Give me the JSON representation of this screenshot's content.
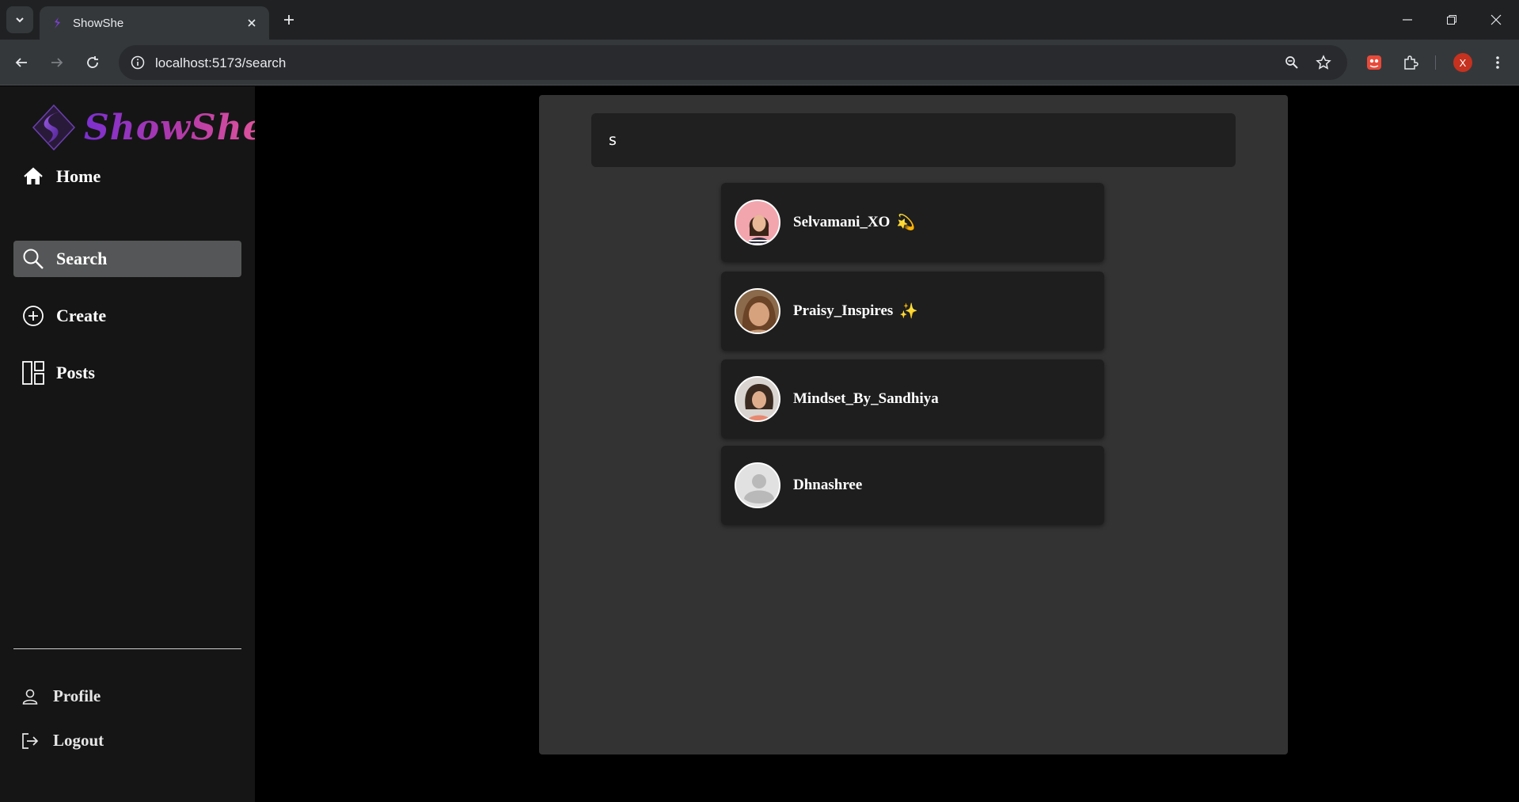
{
  "browser": {
    "tab_title": "ShowShe",
    "url": "localhost:5173/search",
    "profile_initial": "X"
  },
  "app": {
    "brand": "ShowShe",
    "nav": [
      {
        "label": "Home",
        "icon": "home-icon",
        "active": false
      },
      {
        "label": "Search",
        "icon": "search-icon",
        "active": true
      },
      {
        "label": "Create",
        "icon": "plus-circle-icon",
        "active": false
      },
      {
        "label": "Posts",
        "icon": "posts-grid-icon",
        "active": false
      }
    ],
    "bottom_nav": [
      {
        "label": "Profile",
        "icon": "user-icon"
      },
      {
        "label": "Logout",
        "icon": "logout-icon"
      }
    ]
  },
  "search": {
    "query": "s",
    "results": [
      {
        "username": "Selvamani_XO",
        "emoji": "💫",
        "avatar": "avatar-photo"
      },
      {
        "username": "Praisy_Inspires",
        "emoji": "✨",
        "avatar": "avatar-photo"
      },
      {
        "username": "Mindset_By_Sandhiya",
        "emoji": "",
        "avatar": "avatar-photo"
      },
      {
        "username": "Dhnashree",
        "emoji": "",
        "avatar": "default-avatar-icon"
      }
    ]
  },
  "colors": {
    "sidebar_bg": "#151515",
    "panel_bg": "#333333",
    "card_bg": "#1e1e1e",
    "active_nav_bg": "#555657",
    "brand_gradient_start": "#7b2fd0",
    "brand_gradient_end": "#e2569a"
  }
}
